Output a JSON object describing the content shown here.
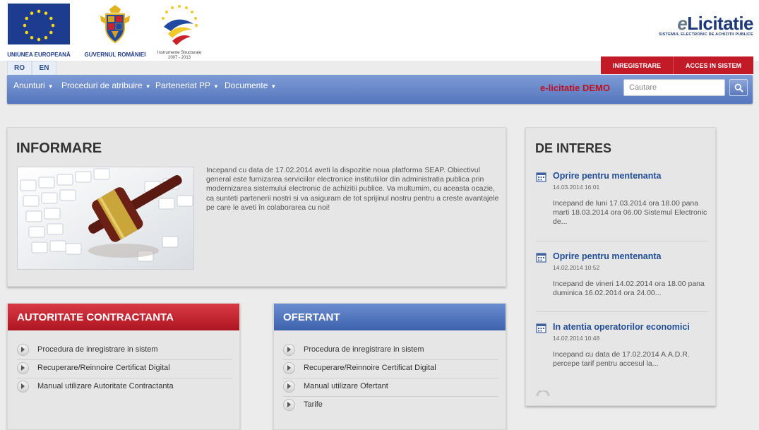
{
  "logos": {
    "eu_label": "UNIUNEA EUROPEANĂ",
    "gov_label": "GUVERNUL ROMÂNIEI",
    "instr_label_1": "Instrumente Structurale",
    "instr_label_2": "2007 - 2013"
  },
  "brand": {
    "prefix": "e",
    "name": "Licitatie",
    "tagline": "SISTEMUL ELECTRONIC DE ACHIZITII PUBLICE"
  },
  "languages": [
    "RO",
    "EN"
  ],
  "auth": {
    "register": "INREGISTRARE",
    "login": "ACCES IN SISTEM"
  },
  "nav": {
    "items": [
      "Anunturi",
      "Proceduri de atribuire",
      "Parteneriat PP",
      "Documente"
    ],
    "demo_label": "e-licitatie DEMO",
    "search_placeholder": "Cautare"
  },
  "informare": {
    "title": "INFORMARE",
    "text": "Incepand cu data de 17.02.2014 aveti la dispozitie noua platforma SEAP. Obiectivul general este furnizarea serviciilor electronice institutiilor din administratia publica prin modernizarea sistemului electronic de achizitii publice. Va multumim, cu aceasta ocazie, ca sunteti partenerii nostri si va asiguram de tot sprijinul nostru pentru a creste avantajele pe care le aveti în colaborarea cu noi!"
  },
  "autoritate": {
    "title": "AUTORITATE CONTRACTANTA",
    "links": [
      "Procedura de inregistrare in sistem",
      "Recuperare/Reinnoire Certificat Digital",
      "Manual utilizare Autoritate Contractanta"
    ]
  },
  "ofertant": {
    "title": "OFERTANT",
    "links": [
      "Procedura de inregistrare in sistem",
      "Recuperare/Reinnoire Certificat Digital",
      "Manual utilizare Ofertant",
      "Tarife"
    ]
  },
  "interes": {
    "title": "DE INTERES",
    "items": [
      {
        "title": "Oprire pentru mentenanta",
        "date": "14.03.2014 16:01",
        "text": "Incepand de luni 17.03.2014 ora 18.00 pana marti 18.03.2014 ora 06.00 Sistemul Electronic de..."
      },
      {
        "title": "Oprire pentru mentenanta",
        "date": "14.02.2014 10:52",
        "text": "Incepand de vineri 14.02.2014 ora 18.00 pana duminica 16.02.2014 ora 24.00..."
      },
      {
        "title": "In atentia operatorilor economici",
        "date": "14.02.2014 10:48",
        "text": "Incepand cu data de 17.02.2014 A.A.D.R. percepe tarif pentru accesul la..."
      }
    ]
  },
  "colors": {
    "accent_red": "#c21a27",
    "nav_blue": "#5576bd",
    "link_blue": "#234e96"
  }
}
